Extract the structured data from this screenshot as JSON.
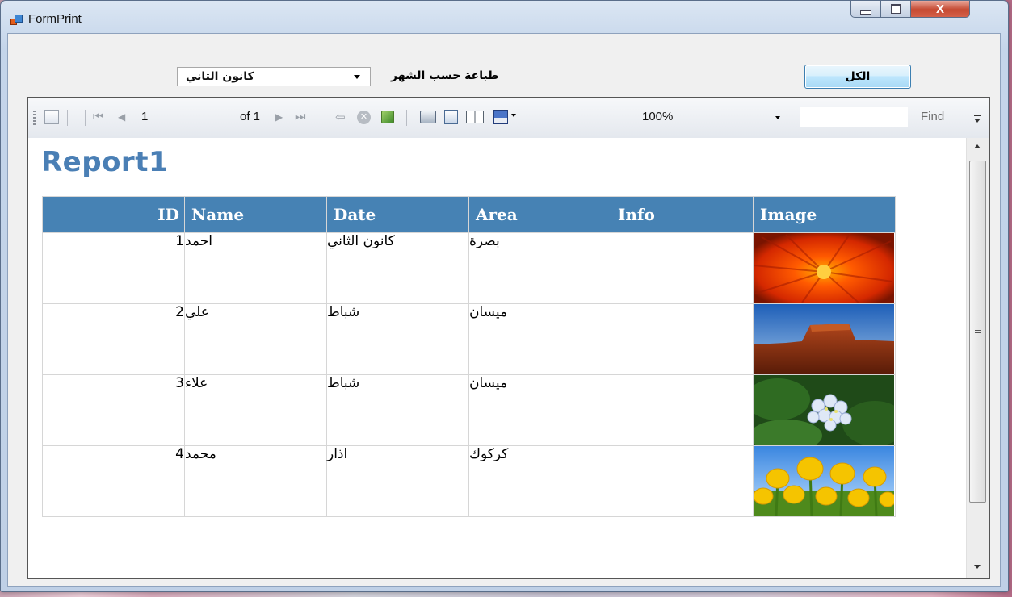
{
  "window": {
    "title": "FormPrint",
    "close_glyph": "X"
  },
  "controls": {
    "month_combo_value": "كانون الثاني",
    "print_by_month_label": "طباعة حسب الشهر",
    "all_button_label": "الكل"
  },
  "toolbar": {
    "page_current": "1",
    "page_of": "of 1",
    "zoom": "100%",
    "find_label": "Find"
  },
  "report": {
    "title": "Report1",
    "columns": [
      "ID",
      "Name",
      "Date",
      "Area",
      "Info",
      "Image"
    ],
    "rows": [
      {
        "id": "1",
        "name": "احمد",
        "date": "كانون الثاني",
        "area": "بصرة",
        "info": "",
        "image": "red-flower"
      },
      {
        "id": "2",
        "name": "علي",
        "date": "شباط",
        "area": "ميسان",
        "info": "",
        "image": "desert-mesa"
      },
      {
        "id": "3",
        "name": "علاء",
        "date": "شباط",
        "area": "ميسان",
        "info": "",
        "image": "hydrangea"
      },
      {
        "id": "4",
        "name": "محمد",
        "date": "اذار",
        "area": "كركوك",
        "info": "",
        "image": "yellow-tulips"
      }
    ]
  },
  "icons": {
    "toolbar": [
      "document-map-icon",
      "first-page-icon",
      "previous-page-icon",
      "next-page-icon",
      "last-page-icon",
      "back-icon",
      "stop-icon",
      "refresh-icon",
      "print-icon",
      "print-layout-icon",
      "page-setup-icon",
      "export-icon"
    ]
  },
  "colors": {
    "report_header_bg": "#4682b4",
    "report_title": "#4a7fb5"
  }
}
